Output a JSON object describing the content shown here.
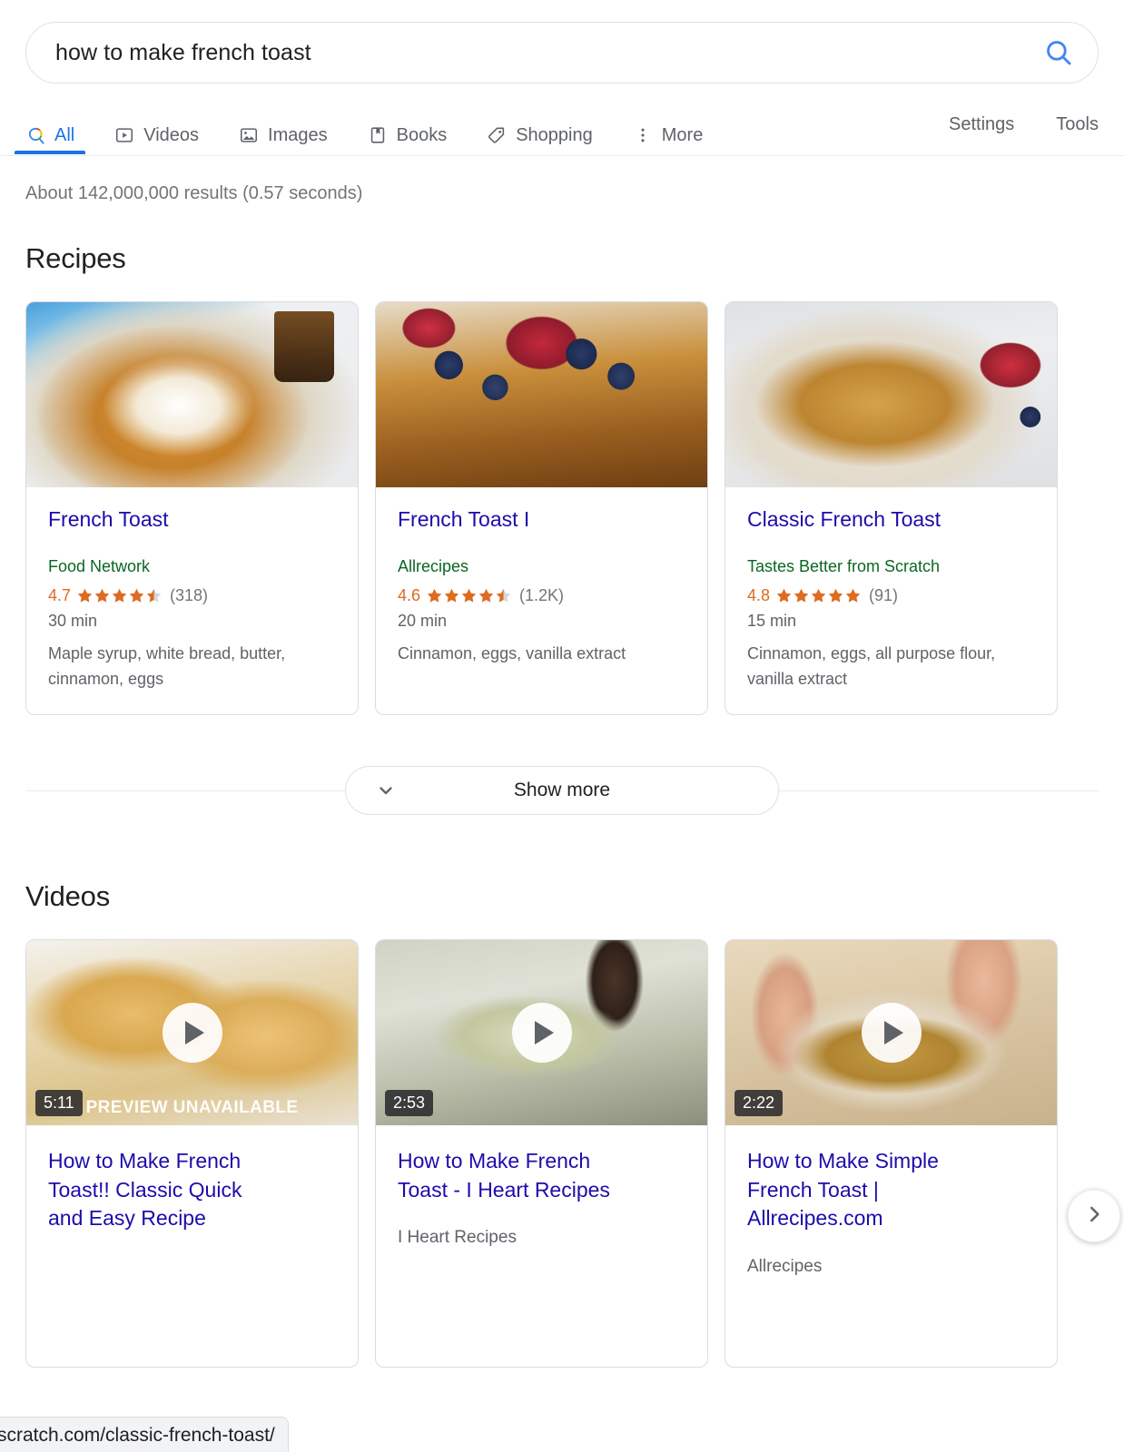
{
  "search": {
    "query": "how to make french toast",
    "icon": "search-icon"
  },
  "nav": {
    "tabs": [
      {
        "label": "All",
        "icon": "google-search-icon",
        "active": true
      },
      {
        "label": "Videos",
        "icon": "video-icon",
        "active": false
      },
      {
        "label": "Images",
        "icon": "image-icon",
        "active": false
      },
      {
        "label": "Books",
        "icon": "book-icon",
        "active": false
      },
      {
        "label": "Shopping",
        "icon": "tag-icon",
        "active": false
      },
      {
        "label": "More",
        "icon": "more-vertical-icon",
        "active": false
      }
    ],
    "settings_label": "Settings",
    "tools_label": "Tools"
  },
  "result_stats": "About 142,000,000 results (0.57 seconds)",
  "recipes": {
    "heading": "Recipes",
    "cards": [
      {
        "title": "French Toast",
        "source": "Food Network",
        "rating": "4.7",
        "stars_filled": 4,
        "stars_half": 1,
        "review_count": "(318)",
        "time": "30 min",
        "ingredients": "Maple syrup, white bread, butter, cinnamon, eggs",
        "image": "french-toast-plate-with-syrup"
      },
      {
        "title": "French Toast I",
        "source": "Allrecipes",
        "rating": "4.6",
        "stars_filled": 4,
        "stars_half": 1,
        "review_count": "(1.2K)",
        "time": "20 min",
        "ingredients": "Cinnamon, eggs, vanilla extract",
        "image": "french-toast-with-berries"
      },
      {
        "title": "Classic French Toast",
        "source": "Tastes Better from Scratch",
        "rating": "4.8",
        "stars_filled": 5,
        "stars_half": 0,
        "review_count": "(91)",
        "time": "15 min",
        "ingredients": "Cinnamon, eggs, all purpose flour, vanilla extract",
        "image": "classic-french-toast-stack"
      }
    ],
    "show_more_label": "Show more"
  },
  "videos": {
    "heading": "Videos",
    "cards": [
      {
        "title": "How to Make French Toast!! Classic Quick and Easy Recipe",
        "publisher": "",
        "duration": "5:11",
        "overlay_text": "PREVIEW UNAVAILABLE",
        "image": "golden-french-toast-slices"
      },
      {
        "title": "How to Make French Toast - I Heart Recipes",
        "publisher": "I Heart Recipes",
        "duration": "2:53",
        "overlay_text": "",
        "image": "bread-soaking-in-egg-batter"
      },
      {
        "title": "How to Make Simple French Toast | Allrecipes.com",
        "publisher": "Allrecipes",
        "duration": "2:22",
        "overlay_text": "",
        "image": "hands-dipping-bread-in-bowl"
      }
    ],
    "next_label": "next-arrow"
  },
  "status_bar": {
    "url": "scratch.com/classic-french-toast/"
  },
  "colors": {
    "link": "#1a0dab",
    "source_green": "#0b6623",
    "rating_orange": "#dd6b20",
    "accent_blue": "#1a73e8",
    "muted": "#70757a"
  }
}
